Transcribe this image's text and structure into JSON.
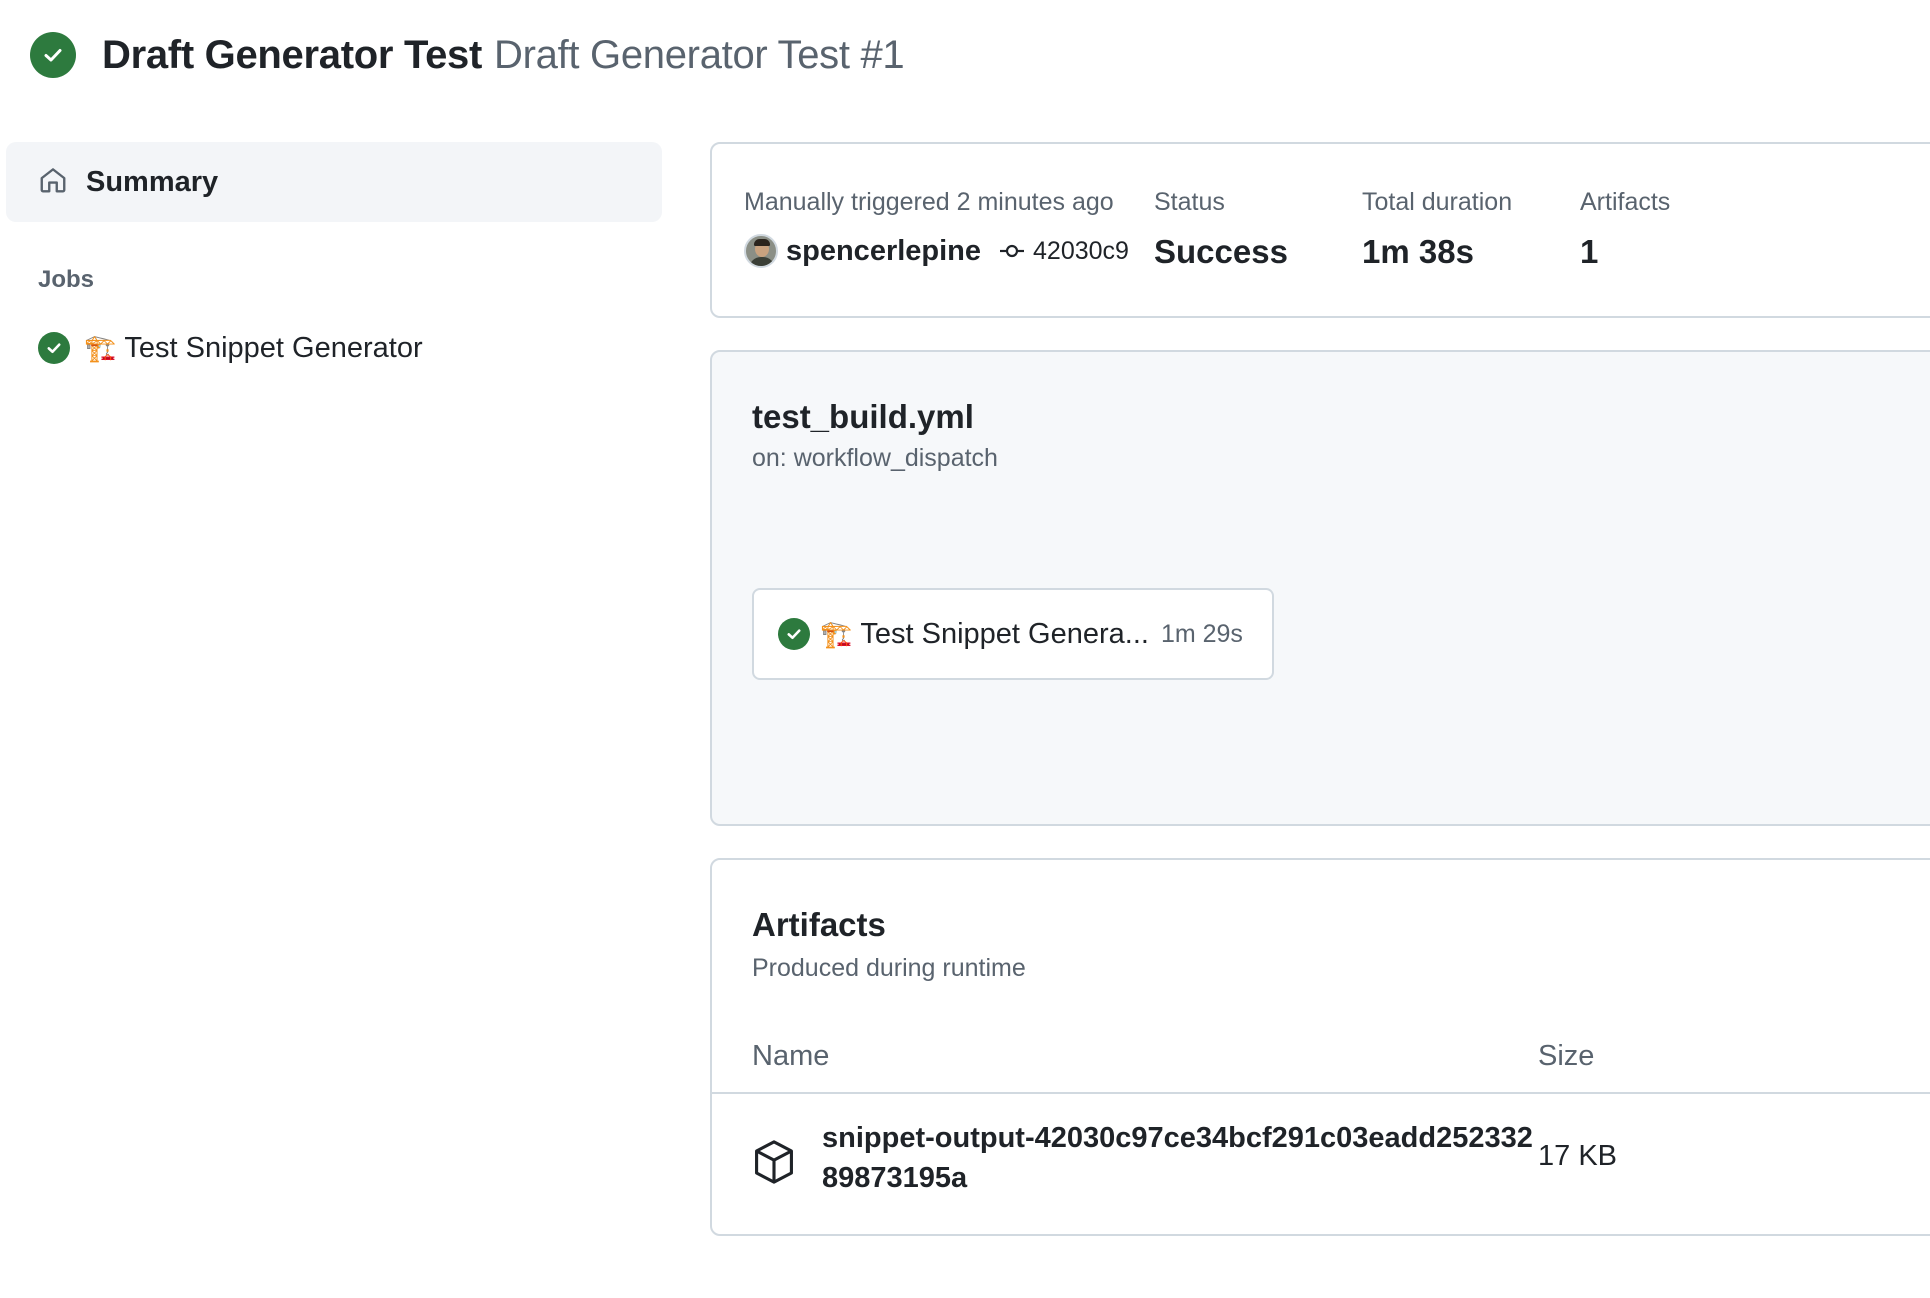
{
  "header": {
    "workflow_name": "Draft Generator Test",
    "run_title": "Draft Generator Test #1",
    "status_icon": "check-circle-fill-icon",
    "status_color": "#2d7a3e"
  },
  "sidebar": {
    "summary_label": "Summary",
    "jobs_heading": "Jobs",
    "jobs": [
      {
        "emoji": "🏗️",
        "label": "Test Snippet Generator",
        "status": "success"
      }
    ]
  },
  "run_meta": {
    "trigger_text": "Manually triggered 2 minutes ago",
    "actor": "spencerlepine",
    "commit_sha": "42030c9",
    "status_label": "Status",
    "status_value": "Success",
    "duration_label": "Total duration",
    "duration_value": "1m 38s",
    "artifacts_label": "Artifacts",
    "artifacts_value": "1"
  },
  "workflow_graph": {
    "file": "test_build.yml",
    "trigger": "on: workflow_dispatch",
    "jobs": [
      {
        "emoji": "🏗️",
        "name": "Test Snippet Genera...",
        "duration": "1m 29s",
        "status": "success"
      }
    ]
  },
  "artifacts": {
    "title": "Artifacts",
    "subtitle": "Produced during runtime",
    "columns": {
      "name": "Name",
      "size": "Size"
    },
    "rows": [
      {
        "name": "snippet-output-42030c97ce34bcf291c03eadd25233289873195a",
        "size": "17 KB",
        "icon": "package-icon"
      }
    ]
  },
  "colors": {
    "success": "#2d7a3e",
    "border": "#d1d9e0",
    "muted_text": "#59636e",
    "sidebar_active_bg": "#f3f5f8",
    "graph_bg": "#f6f8fa"
  }
}
